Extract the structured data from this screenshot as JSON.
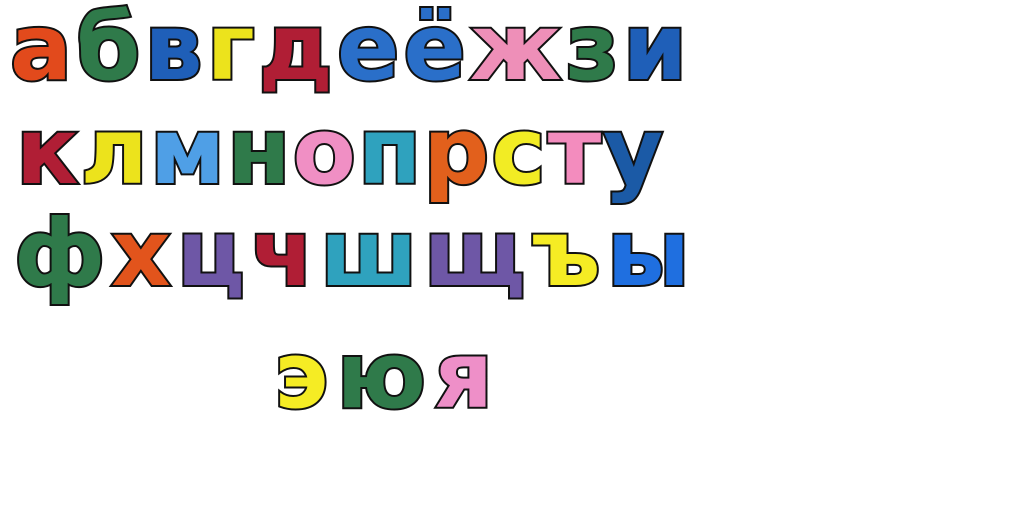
{
  "rows": [
    {
      "letters": [
        {
          "char": "а",
          "color": "#e24a1c"
        },
        {
          "char": "б",
          "color": "#2f7a4a"
        },
        {
          "char": "в",
          "color": "#1f5fb8"
        },
        {
          "char": "г",
          "color": "#ece31c"
        },
        {
          "char": "д",
          "color": "#b01e35"
        },
        {
          "char": "е",
          "color": "#2a6fc9"
        },
        {
          "char": "ё",
          "color": "#2a6fc9"
        },
        {
          "char": "ж",
          "color": "#ee8fb8"
        },
        {
          "char": "з",
          "color": "#2f7a4a"
        },
        {
          "char": "и",
          "color": "#1f5fb8"
        }
      ]
    },
    {
      "letters": [
        {
          "char": "к",
          "color": "#b01e35"
        },
        {
          "char": "л",
          "color": "#ece31c"
        },
        {
          "char": "м",
          "color": "#4f9fe6"
        },
        {
          "char": "н",
          "color": "#2f7a4a"
        },
        {
          "char": "о",
          "color": "#f08fc4"
        },
        {
          "char": "п",
          "color": "#2fa2be"
        },
        {
          "char": "р",
          "color": "#e2601c"
        },
        {
          "char": "с",
          "color": "#f2ec24"
        },
        {
          "char": "т",
          "color": "#f38cbe"
        },
        {
          "char": "у",
          "color": "#1b5aa6"
        }
      ]
    },
    {
      "letters": [
        {
          "char": "ф",
          "color": "#2f7a4a"
        },
        {
          "char": "х",
          "color": "#e2541c"
        },
        {
          "char": "ц",
          "color": "#6e57a6"
        },
        {
          "char": "ч",
          "color": "#b01e35"
        },
        {
          "char": "ш",
          "color": "#2fa2be"
        },
        {
          "char": "щ",
          "color": "#6e57a6"
        },
        {
          "char": "ъ",
          "color": "#f5ec24"
        },
        {
          "char": "ы",
          "color": "#1f6fe0"
        }
      ]
    },
    {
      "letters": [
        {
          "char": "э",
          "color": "#f5ec24"
        },
        {
          "char": "ю",
          "color": "#2f7a4a"
        },
        {
          "char": "я",
          "color": "#ee8fc8"
        }
      ]
    }
  ]
}
